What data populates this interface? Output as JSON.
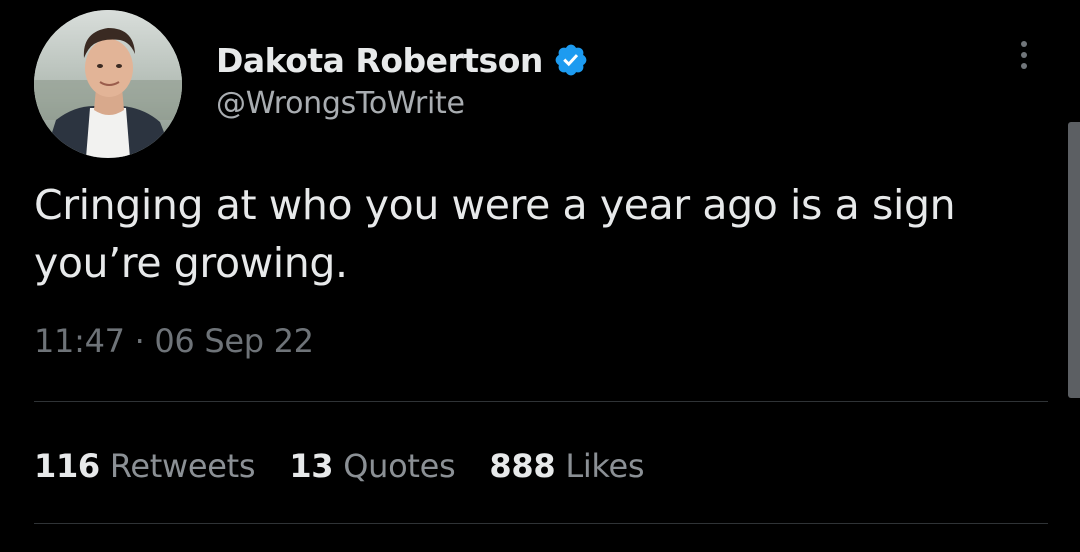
{
  "author": {
    "display_name": "Dakota Robertson",
    "handle": "@WrongsToWrite",
    "verified": true,
    "verified_color": "#1d9bf0"
  },
  "tweet": {
    "text": "Cringing at who you were a year ago is a sign you’re growing.",
    "timestamp": "11:47 · 06 Sep 22"
  },
  "stats": [
    {
      "count": "116",
      "label": "Retweets"
    },
    {
      "count": "13",
      "label": "Quotes"
    },
    {
      "count": "888",
      "label": "Likes"
    }
  ],
  "icons": {
    "more": "more-options-icon",
    "verified": "verified-badge-icon"
  },
  "colors": {
    "background": "#000000",
    "primary_text": "#e7e9ea",
    "secondary_text": "#71767b",
    "divider": "#2f3336"
  }
}
